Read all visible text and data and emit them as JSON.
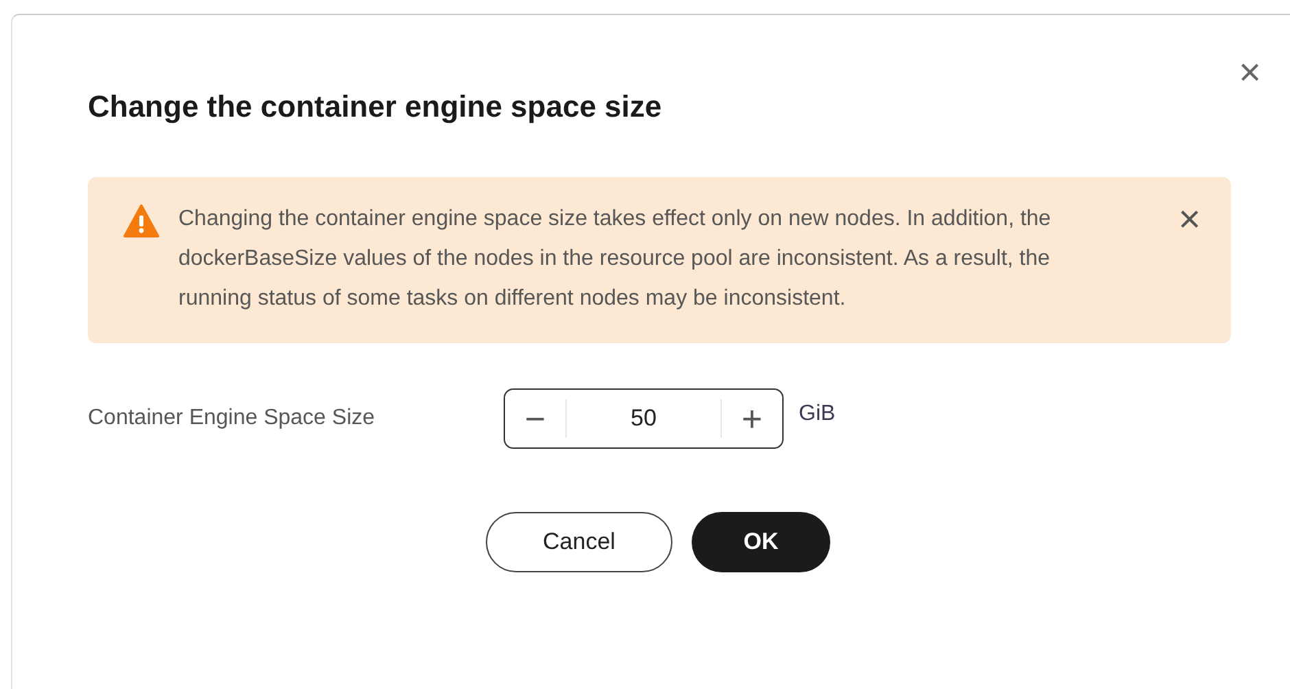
{
  "dialog": {
    "title": "Change the container engine space size",
    "close_label": "×"
  },
  "alert": {
    "message": "Changing the container engine space size takes effect only on new nodes. In addition, the dockerBaseSize values of the nodes in the resource pool are inconsistent. As a result, the running status of some tasks on different nodes may be inconsistent.",
    "dismiss_label": "×"
  },
  "field": {
    "label": "Container Engine Space Size",
    "value": "50",
    "unit": "GiB",
    "decrement": "−",
    "increment": "+"
  },
  "buttons": [
    {
      "label": "Cancel",
      "kind": "secondary"
    },
    {
      "label": "OK",
      "kind": "primary"
    }
  ]
}
